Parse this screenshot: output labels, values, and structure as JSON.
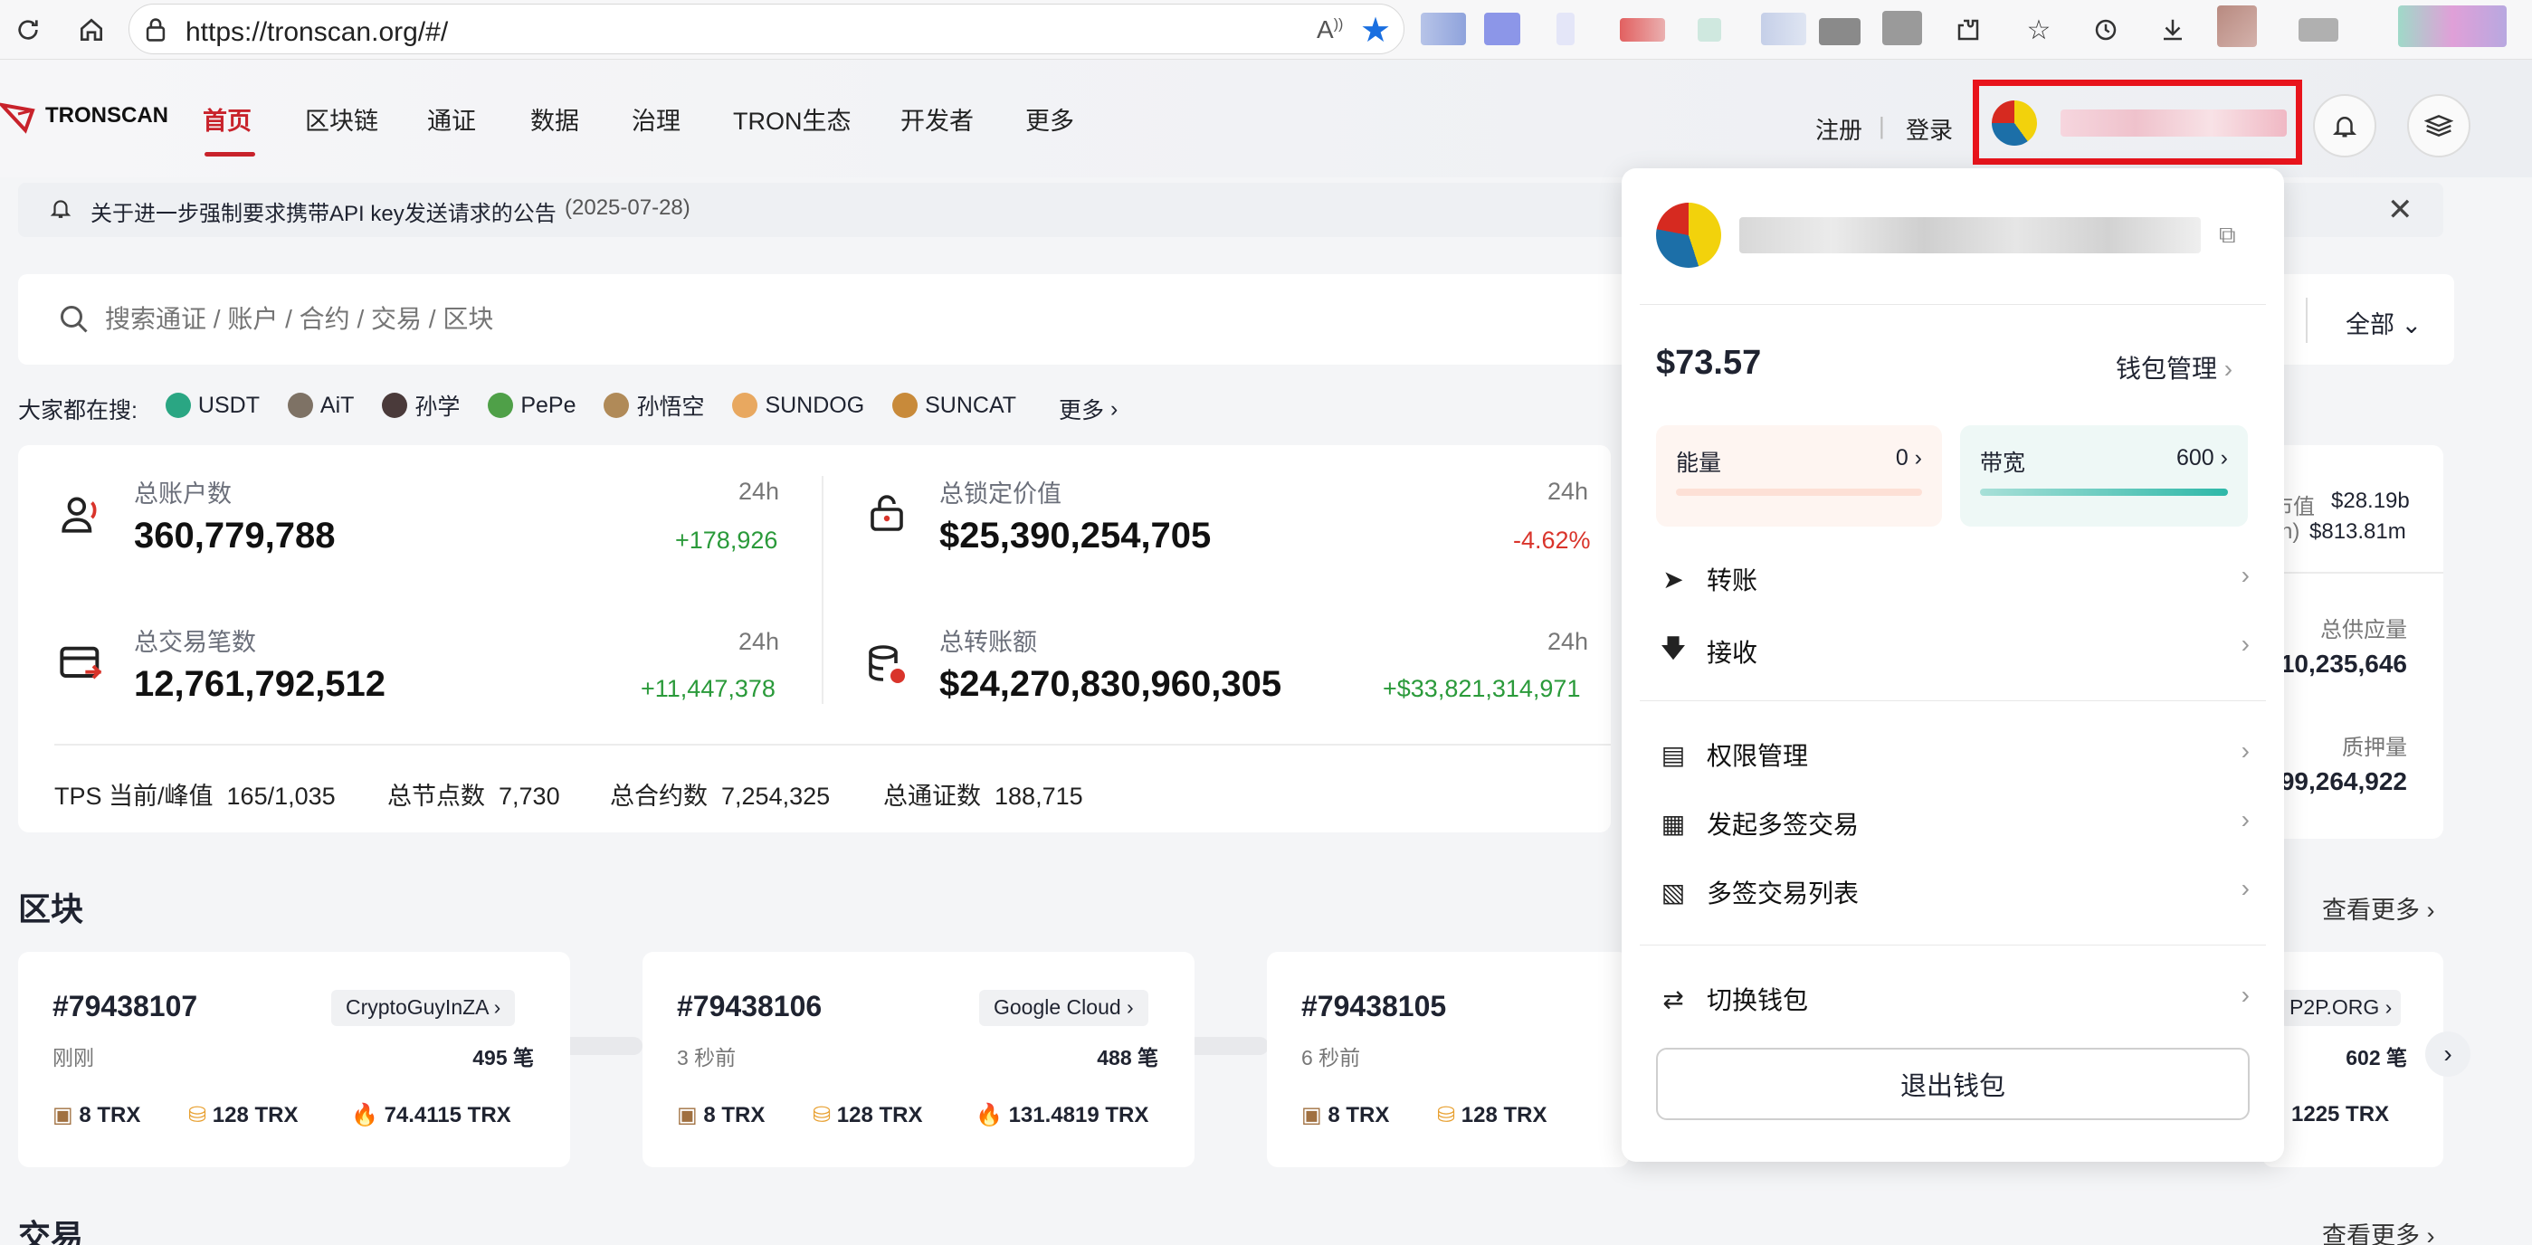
{
  "browser": {
    "url": "https://tronscan.org/#/",
    "icons": [
      "refresh-icon",
      "home-icon",
      "lock-icon",
      "read-aloud-icon",
      "star-icon",
      "extensions-icon",
      "favorites-icon",
      "history-icon",
      "download-icon"
    ]
  },
  "header": {
    "logo_text": "TRONSCAN",
    "nav": [
      "首页",
      "区块链",
      "通证",
      "数据",
      "治理",
      "TRON生态",
      "开发者",
      "更多"
    ],
    "register": "注册",
    "login": "登录"
  },
  "announcement": {
    "text": "关于进一步强制要求携带API key发送请求的公告",
    "date": "(2025-07-28)"
  },
  "search": {
    "placeholder": "搜索通证 / 账户 / 合约 / 交易 / 区块",
    "filter": "全部"
  },
  "hot": {
    "label": "大家都在搜:",
    "items": [
      "USDT",
      "AiT",
      "孙学",
      "PePe",
      "孙悟空",
      "SUNDOG",
      "SUNCAT"
    ],
    "more": "更多"
  },
  "stats": {
    "accounts": {
      "label": "总账户数",
      "value": "360,779,788",
      "period": "24h",
      "change": "+178,926"
    },
    "tvl": {
      "label": "总锁定价值",
      "value": "$25,390,254,705",
      "period": "24h",
      "change": "-4.62%"
    },
    "tx_count": {
      "label": "总交易笔数",
      "value": "12,761,792,512",
      "period": "24h",
      "change": "+11,447,378"
    },
    "transfer": {
      "label": "总转账额",
      "value": "$24,270,830,960,305",
      "period": "24h",
      "change": "+$33,821,314,971"
    },
    "tps_label": "TPS 当前/峰值",
    "tps_value": "165/1,035",
    "nodes_label": "总节点数",
    "nodes_value": "7,730",
    "contracts_label": "总合约数",
    "contracts_value": "7,254,325",
    "tokens_label": "总通证数",
    "tokens_value": "188,715",
    "right_cap_label": "市值",
    "right_cap_value": "$28.19b",
    "right_vol_label": "h)",
    "right_vol_value": "$813.81m",
    "right_supply_label": "总供应量",
    "right_supply_value": "10,235,646",
    "right_stake_label": "质押量",
    "right_stake_value": "99,264,922"
  },
  "blocks_section": {
    "title": "区块",
    "more": "查看更多",
    "blocks": [
      {
        "number": "#79438107",
        "producer": "CryptoGuyInZA",
        "time": "刚刚",
        "tx": "495 笔",
        "r1": "8 TRX",
        "r2": "128 TRX",
        "r3": "74.4115 TRX"
      },
      {
        "number": "#79438106",
        "producer": "Google Cloud",
        "time": "3 秒前",
        "tx": "488 笔",
        "r1": "8 TRX",
        "r2": "128 TRX",
        "r3": "131.4819 TRX"
      },
      {
        "number": "#79438105",
        "producer": "",
        "time": "6 秒前",
        "tx": "",
        "r1": "8 TRX",
        "r2": "128 TRX",
        "r3": ""
      },
      {
        "number": "",
        "producer": "P2P.ORG",
        "time": "",
        "tx": "602 笔",
        "r1": "",
        "r2": "",
        "r3": "1225 TRX"
      }
    ]
  },
  "tx_section": {
    "title": "交易",
    "more": "查看更多"
  },
  "wallet": {
    "balance": "$73.57",
    "manage": "钱包管理",
    "energy_label": "能量",
    "energy_value": "0",
    "energy_fill": 0,
    "bandwidth_label": "带宽",
    "bandwidth_value": "600",
    "bandwidth_fill": 1,
    "menu": [
      {
        "label": "转账",
        "icon": "send-icon"
      },
      {
        "label": "接收",
        "icon": "receive-icon"
      },
      {
        "label": "权限管理",
        "icon": "permission-icon"
      },
      {
        "label": "发起多签交易",
        "icon": "multisig-icon"
      },
      {
        "label": "多签交易列表",
        "icon": "list-icon"
      },
      {
        "label": "切换钱包",
        "icon": "switch-icon"
      }
    ],
    "logout": "退出钱包"
  },
  "colors": {
    "accent": "#c8222b",
    "up": "#2a9a3a",
    "down": "#d9342b",
    "highlight": "#e8141c"
  }
}
